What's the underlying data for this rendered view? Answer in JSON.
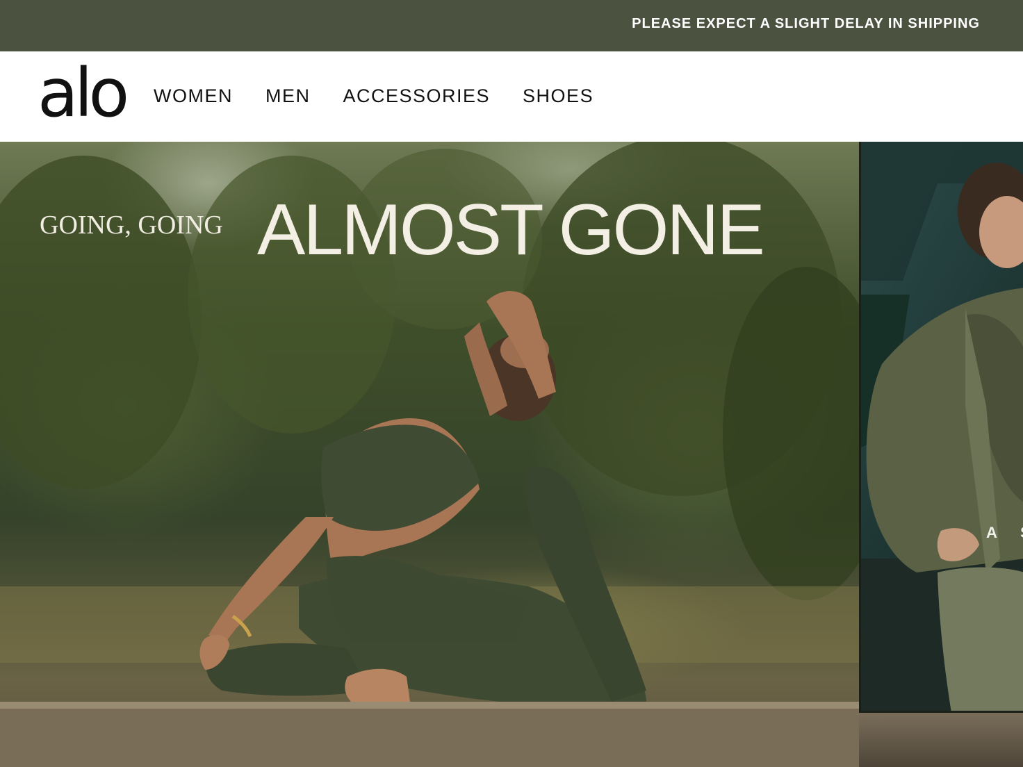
{
  "announcement": {
    "text": "PLEASE EXPECT A SLIGHT DELAY IN SHIPPING"
  },
  "header": {
    "logo": "alo",
    "nav": [
      {
        "label": "WOMEN"
      },
      {
        "label": "MEN"
      },
      {
        "label": "ACCESSORIES"
      },
      {
        "label": "SHOES"
      }
    ]
  },
  "hero": {
    "kicker": "GOING, GOING",
    "headline": "ALMOST GONE",
    "next_slide_text": "A S"
  },
  "colors": {
    "announcement_bg": "#4b5240",
    "header_bg": "#ffffff",
    "text_dark": "#111111",
    "hero_text": "#f3efe4"
  }
}
